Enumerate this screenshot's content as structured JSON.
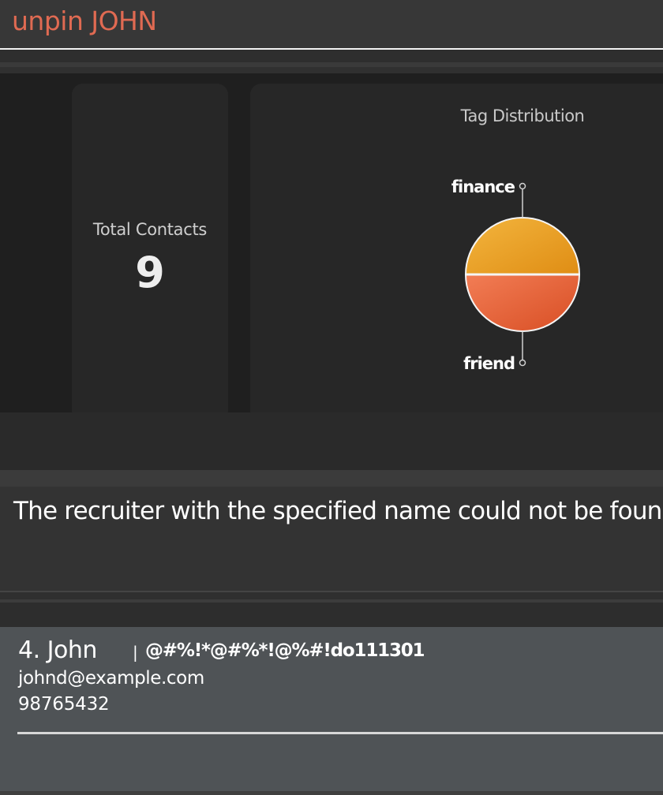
{
  "command_box": {
    "text": "unpin JOHN",
    "text_color": "#e06a52"
  },
  "dashboard": {
    "total_contacts": {
      "label": "Total Contacts",
      "value": "9"
    },
    "tag_distribution": {
      "title": "Tag Distribution"
    }
  },
  "chart_data": {
    "type": "pie",
    "title": "Tag Distribution",
    "series": [
      {
        "name": "finance",
        "value": 1,
        "color": "#eda328"
      },
      {
        "name": "friend",
        "value": 1,
        "color": "#e8643a"
      }
    ]
  },
  "result_display": {
    "message": "The recruiter with the specified name could not be found"
  },
  "person_list": [
    {
      "index_name": "4. John",
      "separator": "|",
      "tag": "@#%!*@#%*!@%#!do111301",
      "email": "johnd@example.com",
      "phone": "98765432"
    }
  ]
}
